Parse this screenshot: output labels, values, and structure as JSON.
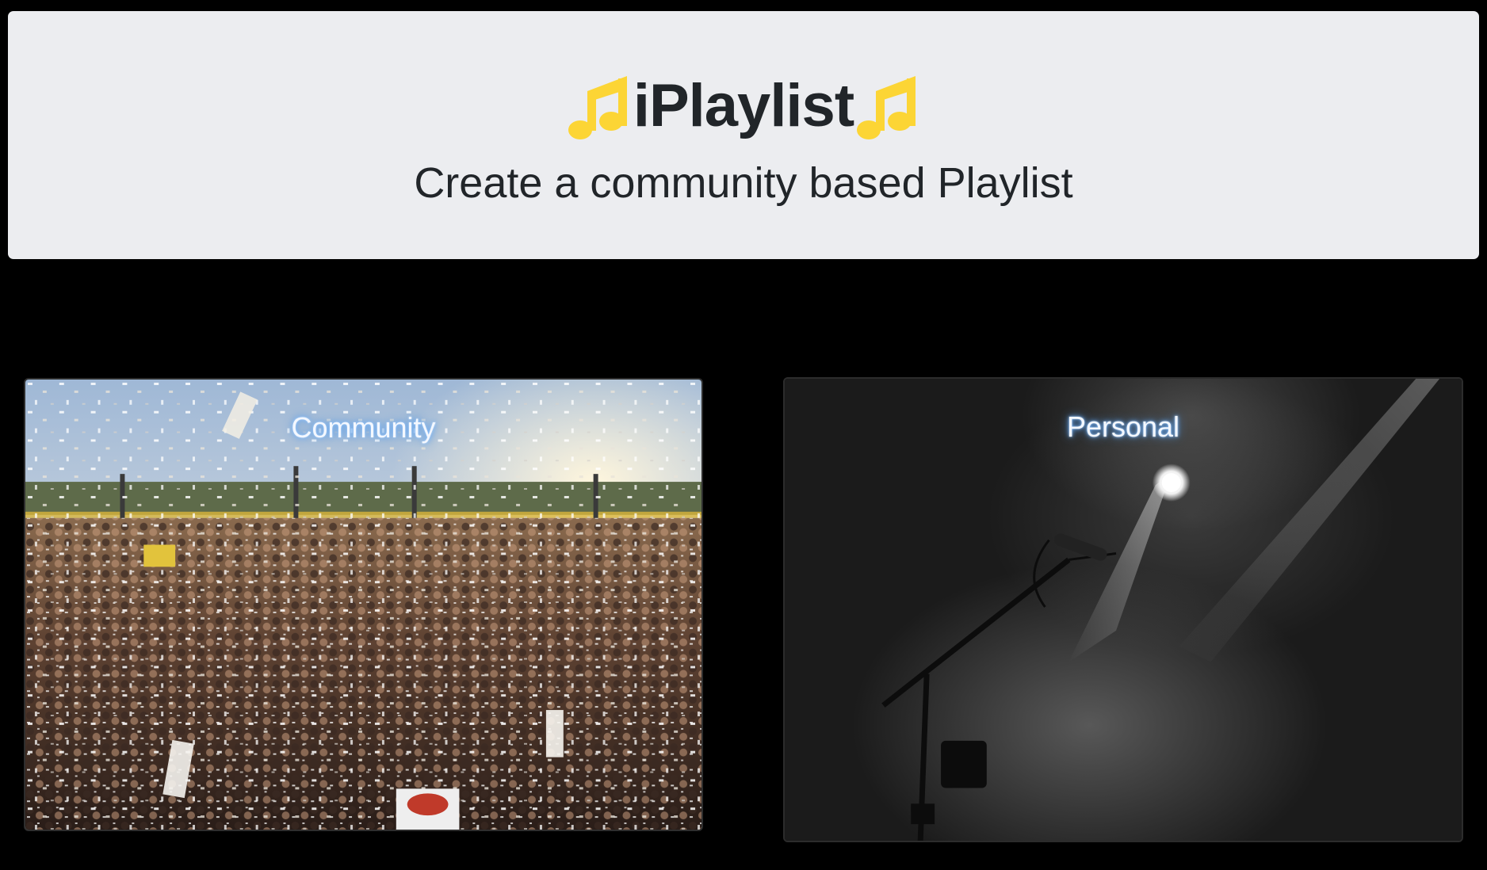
{
  "header": {
    "title": "iPlaylist",
    "title_icon": "musical-note-icon",
    "accent_color": "#fcd535",
    "subtitle": "Create a community based Playlist"
  },
  "cards": [
    {
      "label": "Community",
      "image": "concert-crowd-photo"
    },
    {
      "label": "Personal",
      "image": "microphone-stage-photo"
    }
  ]
}
